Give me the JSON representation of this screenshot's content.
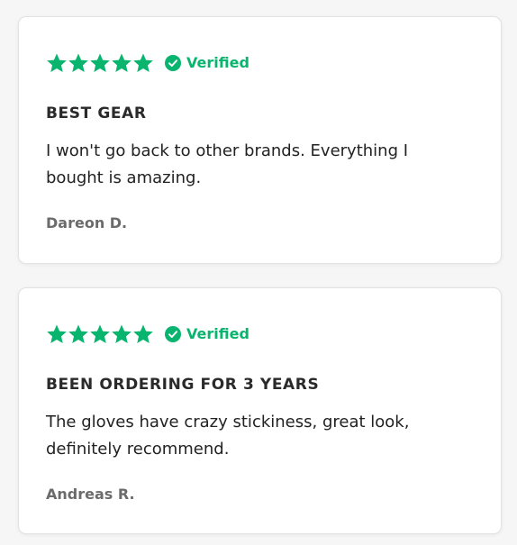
{
  "reviews": [
    {
      "rating": 5,
      "verified_label": "Verified",
      "title": "BEST GEAR",
      "body": "I won't go back to other brands. Everything I bought is amazing.",
      "author": "Dareon D."
    },
    {
      "rating": 5,
      "verified_label": "Verified",
      "title": "BEEN ORDERING FOR 3 YEARS",
      "body": "The gloves have crazy stickiness, great look, definitely recommend.",
      "author": "Andreas R."
    }
  ],
  "icons": {
    "star": "star-icon",
    "verified": "check-circle-icon"
  },
  "colors": {
    "accent_green": "#08b46e",
    "title_text": "#2a2a2a",
    "body_text": "#222222",
    "author_text": "#6b6b6b",
    "card_background": "#ffffff",
    "page_background": "#f6f6f6"
  }
}
